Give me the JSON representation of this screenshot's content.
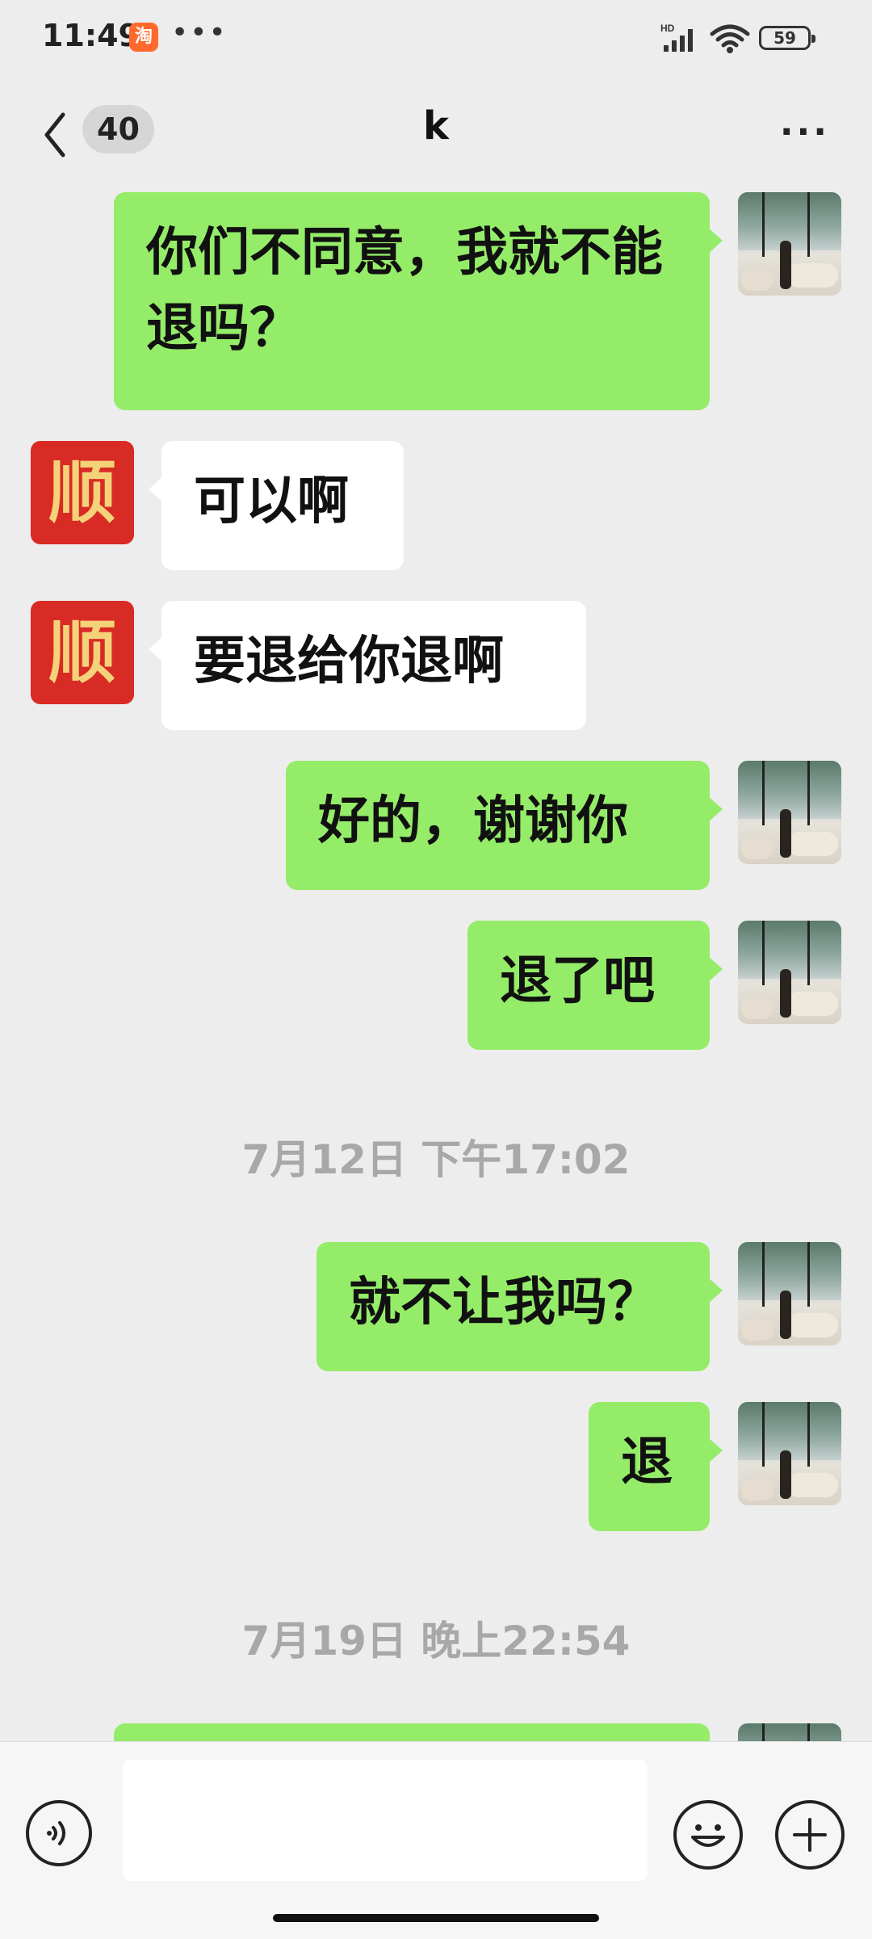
{
  "status_bar": {
    "time": "11:49",
    "app_icon": "淘",
    "more": "•••",
    "network": "HD",
    "battery": "59"
  },
  "nav": {
    "unread_count": "40",
    "title": "k"
  },
  "messages": [
    {
      "side": "me",
      "text": "你们不同意，我就不能退吗？"
    },
    {
      "side": "them",
      "avatar_text": "顺",
      "text": "可以啊"
    },
    {
      "side": "them",
      "avatar_text": "顺",
      "text": "要退给你退啊"
    },
    {
      "side": "me",
      "text": "好的，谢谢你"
    },
    {
      "side": "me",
      "text": "退了吧"
    },
    {
      "timestamp": "7月12日 下午17:02"
    },
    {
      "side": "me",
      "text": "就不让我吗？"
    },
    {
      "side": "me",
      "text": "退"
    },
    {
      "timestamp": "7月19日 晚上22:54"
    },
    {
      "side": "me",
      "text": ""
    }
  ],
  "input": {
    "value": "",
    "placeholder": ""
  },
  "colors": {
    "me_bubble": "#95ec69",
    "them_bubble": "#ffffff",
    "background": "#ededed",
    "avatar_red": "#d92b25"
  },
  "icons": {
    "back": "chevron-left-icon",
    "more": "more-icon",
    "voice": "voice-icon",
    "emoji": "emoji-icon",
    "plus": "plus-icon"
  }
}
